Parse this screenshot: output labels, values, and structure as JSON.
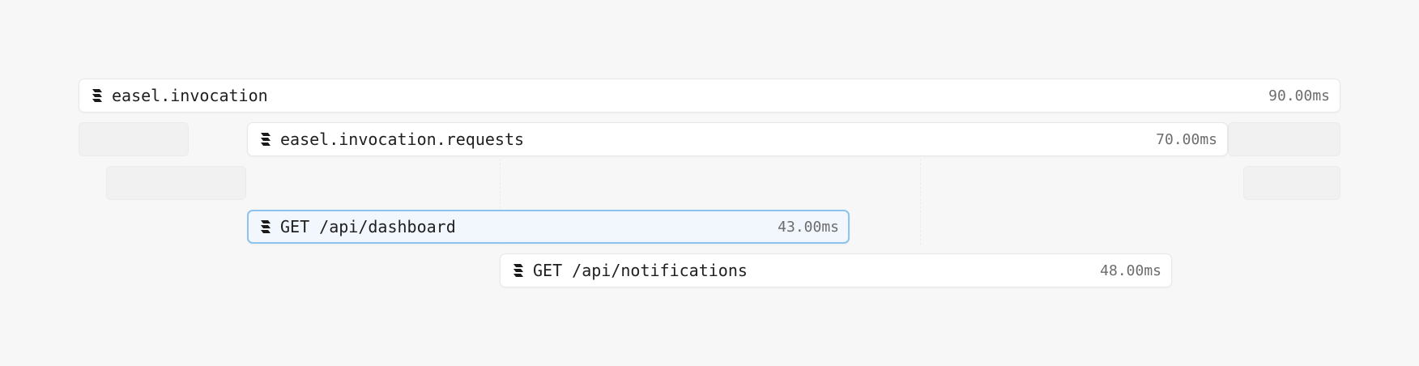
{
  "spans": [
    {
      "name": "easel.invocation",
      "duration": "90.00ms",
      "icon": "logo-icon"
    },
    {
      "name": "easel.invocation.requests",
      "duration": "70.00ms",
      "icon": "logo-icon"
    },
    {
      "name": "GET /api/dashboard",
      "duration": "43.00ms",
      "icon": "logo-icon"
    },
    {
      "name": "GET /api/notifications",
      "duration": "48.00ms",
      "icon": "logo-icon"
    }
  ],
  "colors": {
    "background": "#f7f7f7",
    "span_background": "#ffffff",
    "selected_background": "#f1f7fd",
    "selected_border": "#8cc4ee"
  }
}
